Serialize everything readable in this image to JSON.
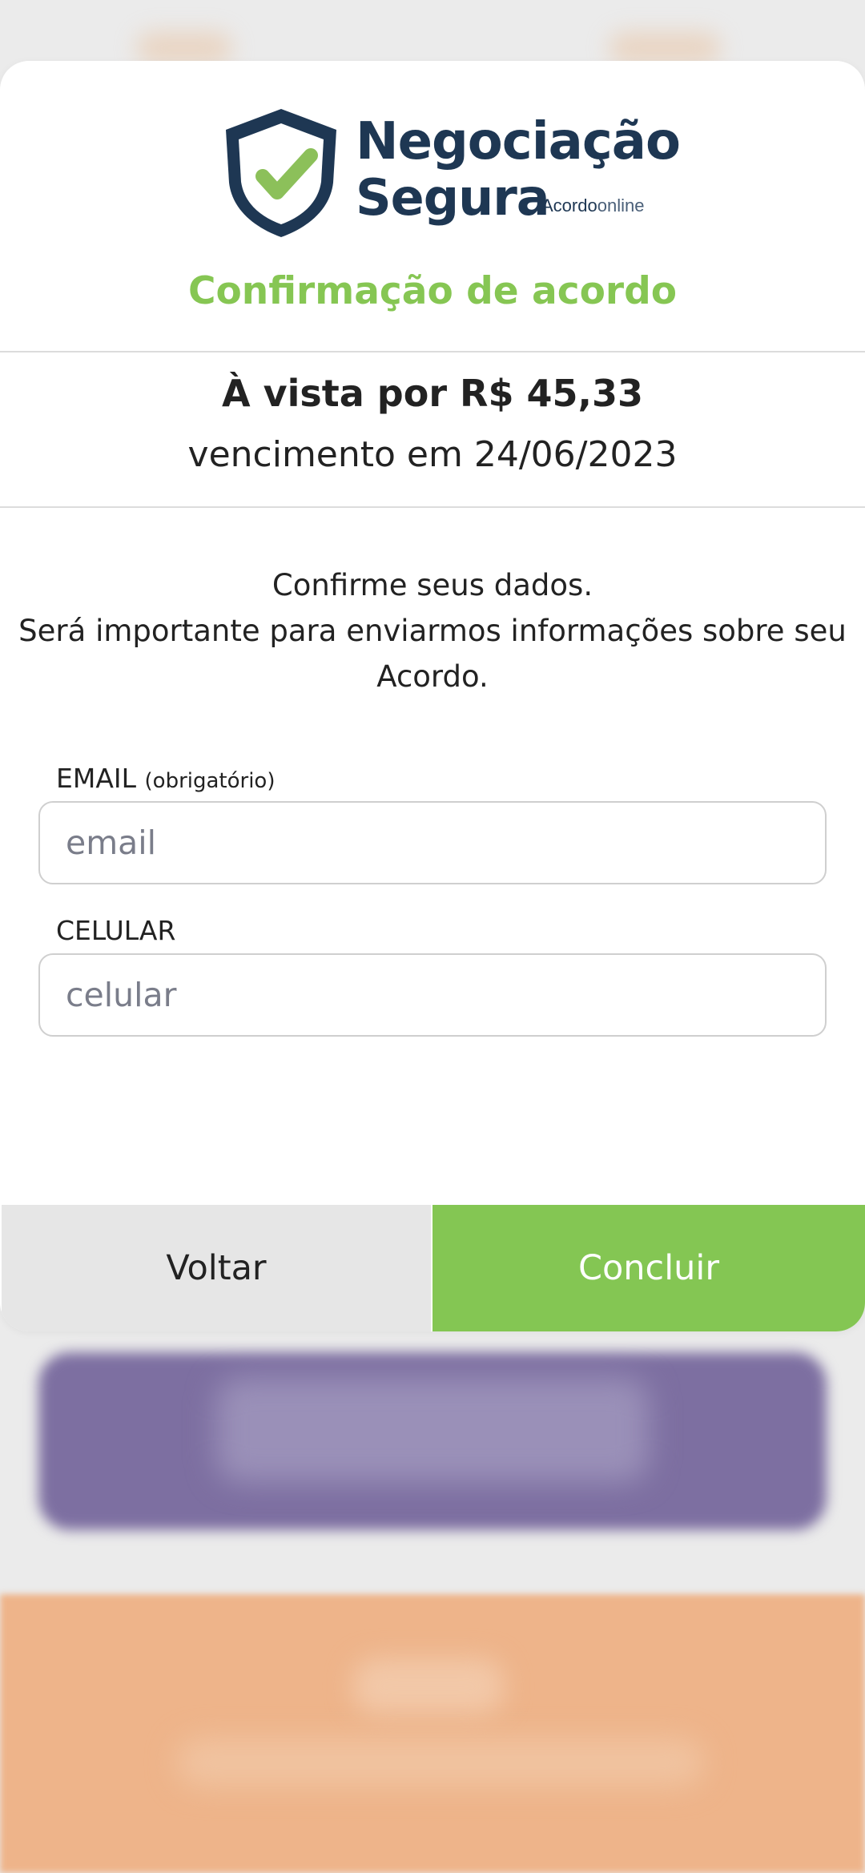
{
  "brand": {
    "name_line1": "Negociação",
    "name_line2": "Segura",
    "sub_bold": "Acordo",
    "sub_light": "online",
    "accent_color": "#86c653",
    "primary_color": "#1e3753"
  },
  "dialog": {
    "title": "Confirmação de acordo",
    "price_text": "À vista por R$ 45,33",
    "due_text": "vencimento em 24/06/2023",
    "info_line1": "Confirme seus dados.",
    "info_line2": "Será importante para enviarmos informações sobre seu Acordo."
  },
  "form": {
    "email_label": "EMAIL",
    "email_required": "(obrigatório)",
    "email_placeholder": "email",
    "email_value": "",
    "phone_label": "CELULAR",
    "phone_placeholder": "celular",
    "phone_value": ""
  },
  "actions": {
    "back_label": "Voltar",
    "confirm_label": "Concluir"
  },
  "icons": {
    "logo": "shield-check-icon"
  }
}
